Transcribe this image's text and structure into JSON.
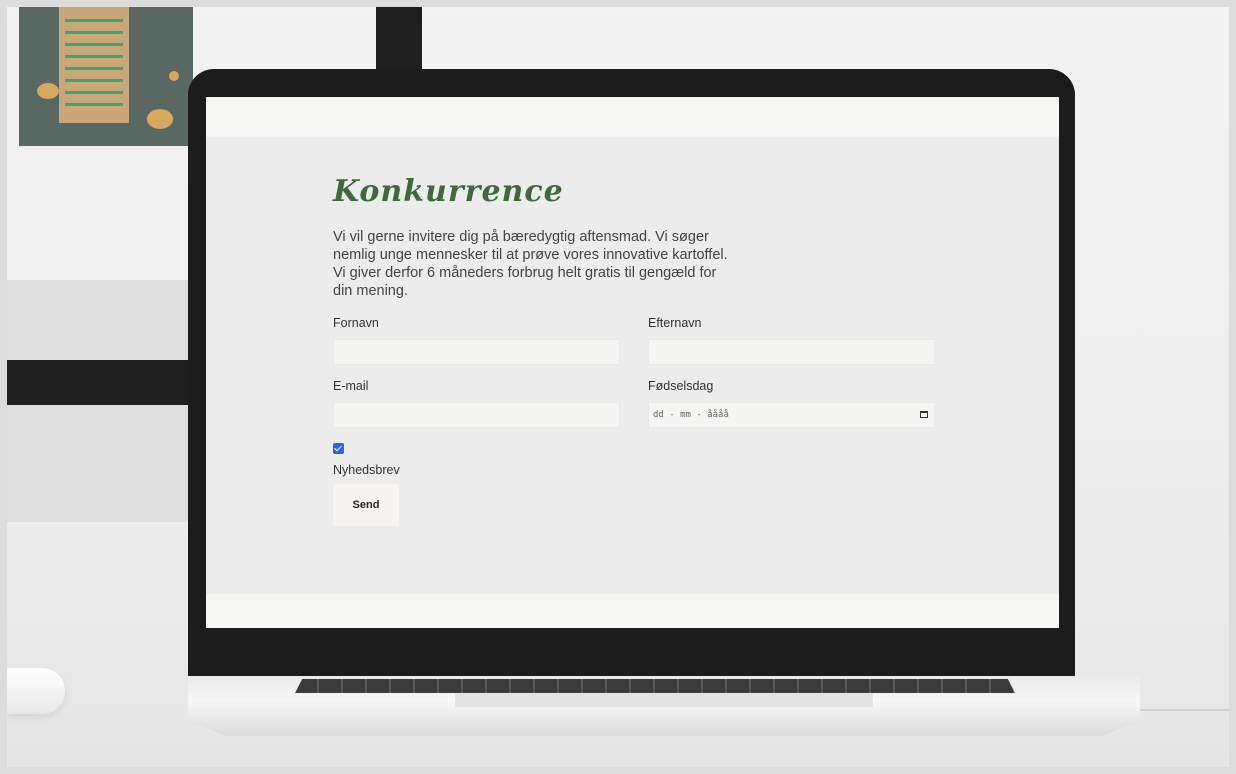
{
  "page": {
    "title": "Konkurrence",
    "intro_lines": [
      "Vi vil gerne invitere dig på bæredygtig aftensmad. Vi søger",
      "nemlig unge mennesker til at prøve vores innovative kartoffel.",
      "Vi giver derfor 6 måneders forbrug helt gratis til gengæld for",
      "din mening."
    ]
  },
  "form": {
    "first_name_label": "Fornavn",
    "last_name_label": "Efternavn",
    "email_label": "E-mail",
    "birthday_label": "Fødselsdag",
    "birthday_placeholder": "dd - mm - åååå",
    "newsletter_label": "Nyhedsbrev",
    "newsletter_checked": true,
    "send_label": "Send"
  },
  "colors": {
    "title_green": "#3f6b3c",
    "checkbox_blue": "#2563eb",
    "laptop_bezel": "#1c1c1c"
  }
}
